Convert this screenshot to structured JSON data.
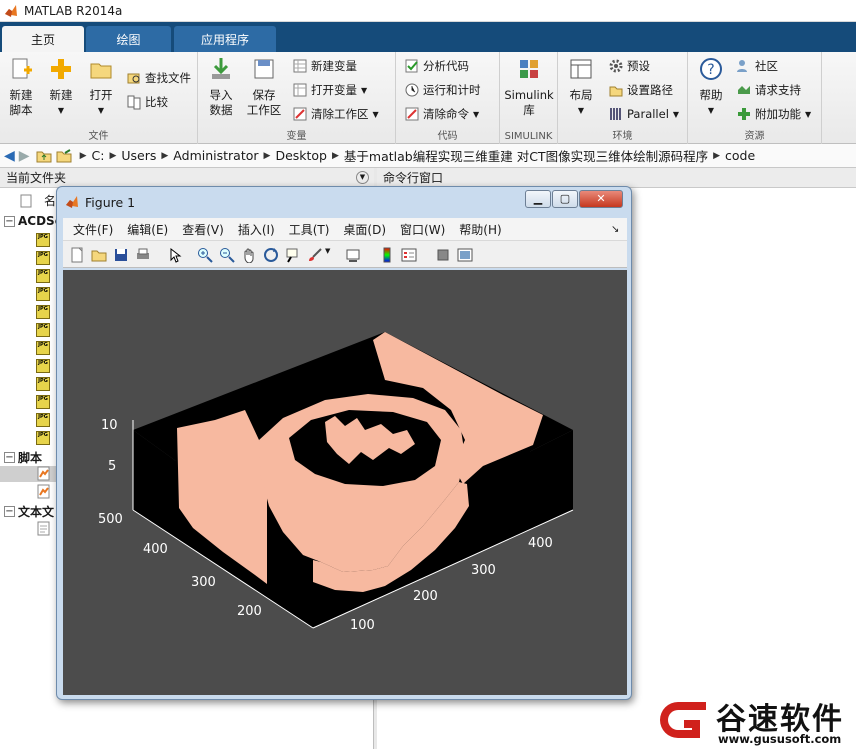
{
  "window": {
    "title": "MATLAB R2014a"
  },
  "tabs": [
    {
      "label": "主页"
    },
    {
      "label": "绘图"
    },
    {
      "label": "应用程序"
    }
  ],
  "ribbon": {
    "groups": [
      {
        "label": "文件"
      },
      {
        "label": "变量"
      },
      {
        "label": "代码"
      },
      {
        "label": "SIMULINK"
      },
      {
        "label": "环境"
      },
      {
        "label": "资源"
      }
    ],
    "file": {
      "new_script": "新建\n脚本",
      "new": "新建",
      "open": "打开",
      "find_files": "查找文件",
      "compare": "比较"
    },
    "variable": {
      "import": "导入\n数据",
      "save_ws": "保存\n工作区",
      "new_var": "新建变量",
      "open_var": "打开变量",
      "clear_ws": "清除工作区"
    },
    "code": {
      "analyze": "分析代码",
      "run_time": "运行和计时",
      "clear_cmd": "清除命令"
    },
    "simulink": {
      "lib": "Simulink\n库"
    },
    "env": {
      "layout": "布局",
      "prefs": "预设",
      "set_path": "设置路径",
      "parallel": "Parallel"
    },
    "resources": {
      "help": "帮助",
      "community": "社区",
      "support": "请求支持",
      "addons": "附加功能"
    }
  },
  "address": {
    "crumbs": [
      "C:",
      "Users",
      "Administrator",
      "Desktop",
      "基于matlab编程实现三维重建 对CT图像实现三维体绘制源码程序",
      "code"
    ]
  },
  "current_folder": {
    "title": "当前文件夹",
    "name_col": "名",
    "tree": [
      {
        "label": "ACDSe"
      },
      {
        "label": "脚本"
      },
      {
        "label": "文本文"
      }
    ]
  },
  "command_window": {
    "title": "命令行窗口"
  },
  "figure": {
    "title": "Figure 1",
    "menu": [
      "文件(F)",
      "编辑(E)",
      "查看(V)",
      "插入(I)",
      "工具(T)",
      "桌面(D)",
      "窗口(W)",
      "帮助(H)"
    ],
    "axes": {
      "z_ticks": [
        "10",
        "5"
      ],
      "y_ticks": [
        "500",
        "400",
        "300",
        "200"
      ],
      "x_ticks": [
        "100",
        "200",
        "300",
        "400"
      ]
    }
  },
  "watermark": {
    "name": "谷速软件",
    "url": "www.gususoft.com"
  },
  "colors": {
    "tab_blue": "#154b7a",
    "surface": "#f7b9a0",
    "axes_bg": "#000000",
    "fig_bg": "#4c4c4c",
    "watermark_red": "#d0211c"
  }
}
